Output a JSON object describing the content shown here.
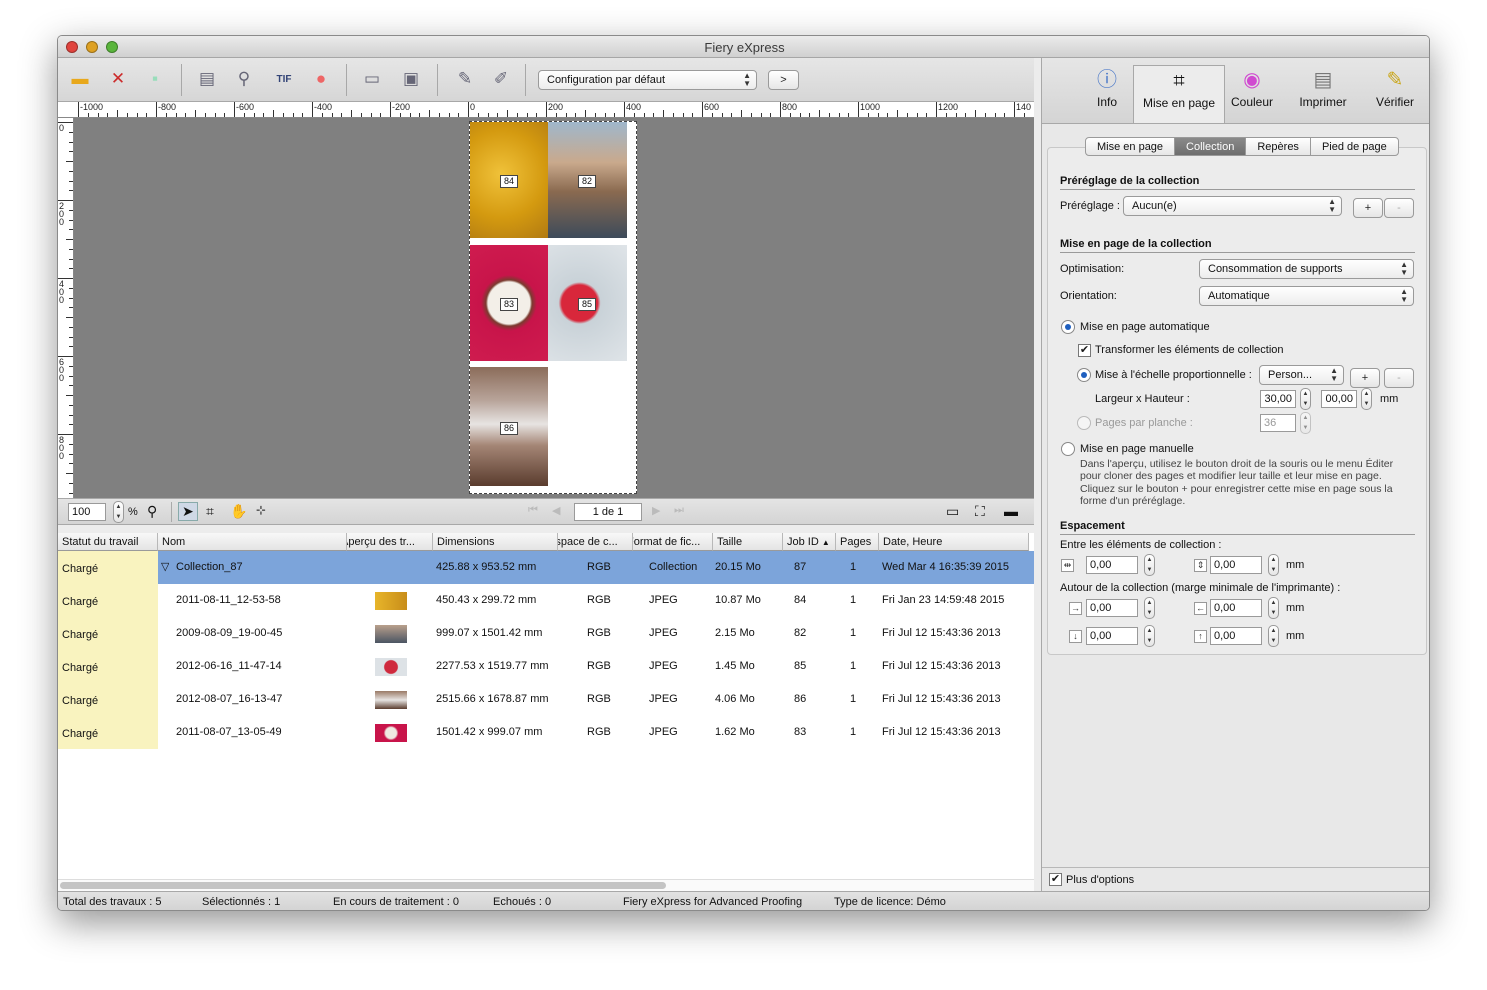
{
  "window": {
    "title": "Fiery eXpress"
  },
  "toolbar": {
    "config_select": "Configuration par défaut",
    "go_label": ">"
  },
  "ruler": {
    "h_labels": [
      "-1000",
      "-800",
      "-600",
      "-400",
      "-200",
      "0",
      "200",
      "400",
      "600",
      "800",
      "1000",
      "1200",
      "140"
    ],
    "v_labels": [
      "0",
      "200",
      "400",
      "600",
      "800"
    ]
  },
  "preview": {
    "tiles": [
      {
        "num": "84"
      },
      {
        "num": "82"
      },
      {
        "num": "83"
      },
      {
        "num": "85"
      },
      {
        "num": "86"
      }
    ]
  },
  "zoombar": {
    "zoom_value": "100",
    "zoom_unit": "%",
    "page_indicator": "1 de 1"
  },
  "table": {
    "columns": [
      "Statut du travail",
      "Nom",
      "Aperçu des tr...",
      "Dimensions",
      "Espace de c...",
      "Format de fic...",
      "Taille",
      "Job ID",
      "Pages",
      "Date, Heure"
    ],
    "rows": [
      {
        "status": "Chargé",
        "name": "Collection_87",
        "dims": "425.88 x 953.52 mm",
        "space": "RGB",
        "format": "Collection",
        "size": "20.15 Mo",
        "id": "87",
        "pages": "1",
        "date": "Wed Mar  4 16:35:39 2015"
      },
      {
        "status": "Chargé",
        "name": "2011-08-11_12-53-58",
        "dims": "450.43 x 299.72 mm",
        "space": "RGB",
        "format": "JPEG",
        "size": "10.87 Mo",
        "id": "84",
        "pages": "1",
        "date": "Fri Jan 23 14:59:48 2015"
      },
      {
        "status": "Chargé",
        "name": "2009-08-09_19-00-45",
        "dims": "999.07 x 1501.42 mm",
        "space": "RGB",
        "format": "JPEG",
        "size": "2.15 Mo",
        "id": "82",
        "pages": "1",
        "date": "Fri Jul 12 15:43:36 2013"
      },
      {
        "status": "Chargé",
        "name": "2012-06-16_11-47-14",
        "dims": "2277.53 x 1519.77 mm",
        "space": "RGB",
        "format": "JPEG",
        "size": "1.45 Mo",
        "id": "85",
        "pages": "1",
        "date": "Fri Jul 12 15:43:36 2013"
      },
      {
        "status": "Chargé",
        "name": "2012-08-07_16-13-47",
        "dims": "2515.66 x 1678.87 mm",
        "space": "RGB",
        "format": "JPEG",
        "size": "4.06 Mo",
        "id": "86",
        "pages": "1",
        "date": "Fri Jul 12 15:43:36 2013"
      },
      {
        "status": "Chargé",
        "name": "2011-08-07_13-05-49",
        "dims": "1501.42 x 999.07 mm",
        "space": "RGB",
        "format": "JPEG",
        "size": "1.62 Mo",
        "id": "83",
        "pages": "1",
        "date": "Fri Jul 12 15:43:36 2013"
      }
    ]
  },
  "status": {
    "total": "Total des travaux : 5",
    "selected": "Sélectionnés : 1",
    "processing": "En cours de traitement : 0",
    "failed": "Echoués : 0",
    "product": "Fiery eXpress for Advanced Proofing",
    "license": "Type de licence: Démo"
  },
  "rtabs": [
    "Info",
    "Mise en page",
    "Couleur",
    "Imprimer",
    "Vérifier"
  ],
  "subtabs": [
    "Mise en page",
    "Collection",
    "Repères",
    "Pied de page"
  ],
  "panel": {
    "preset_section": "Préréglage de la collection",
    "preset_label": "Préréglage :",
    "preset_value": "Aucun(e)",
    "plus": "+",
    "minus": "-",
    "layout_section": "Mise en page de la collection",
    "optim_label": "Optimisation:",
    "optim_value": "Consommation de supports",
    "orient_label": "Orientation:",
    "orient_value": "Automatique",
    "auto_label": "Mise en page automatique",
    "transform_label": "Transformer les éléments de collection",
    "scale_label": "Mise à l'échelle proportionnelle :",
    "scale_value": "Person...",
    "wh_label": "Largeur x Hauteur :",
    "width_value": "30,00",
    "height_value": "00,00",
    "mm": "mm",
    "pages_label": "Pages par planche :",
    "pages_value": "36",
    "manual_label": "Mise en page manuelle",
    "manual_desc": [
      "Dans l'aperçu, utilisez le bouton droit de la souris ou le menu Éditer",
      "pour cloner des pages et modifier leur taille et leur mise en page.",
      "Cliquez sur le bouton + pour enregistrer cette mise en page sous la",
      "forme d'un préréglage."
    ],
    "spacing_section": "Espacement",
    "between_label": "Entre les éléments de collection :",
    "between_h": "0,00",
    "between_v": "0,00",
    "around_label": "Autour de la collection (marge minimale de l'imprimante) :",
    "around_left": "0,00",
    "around_right": "0,00",
    "around_bottom": "0,00",
    "around_top": "0,00",
    "more_options": "Plus d'options"
  }
}
